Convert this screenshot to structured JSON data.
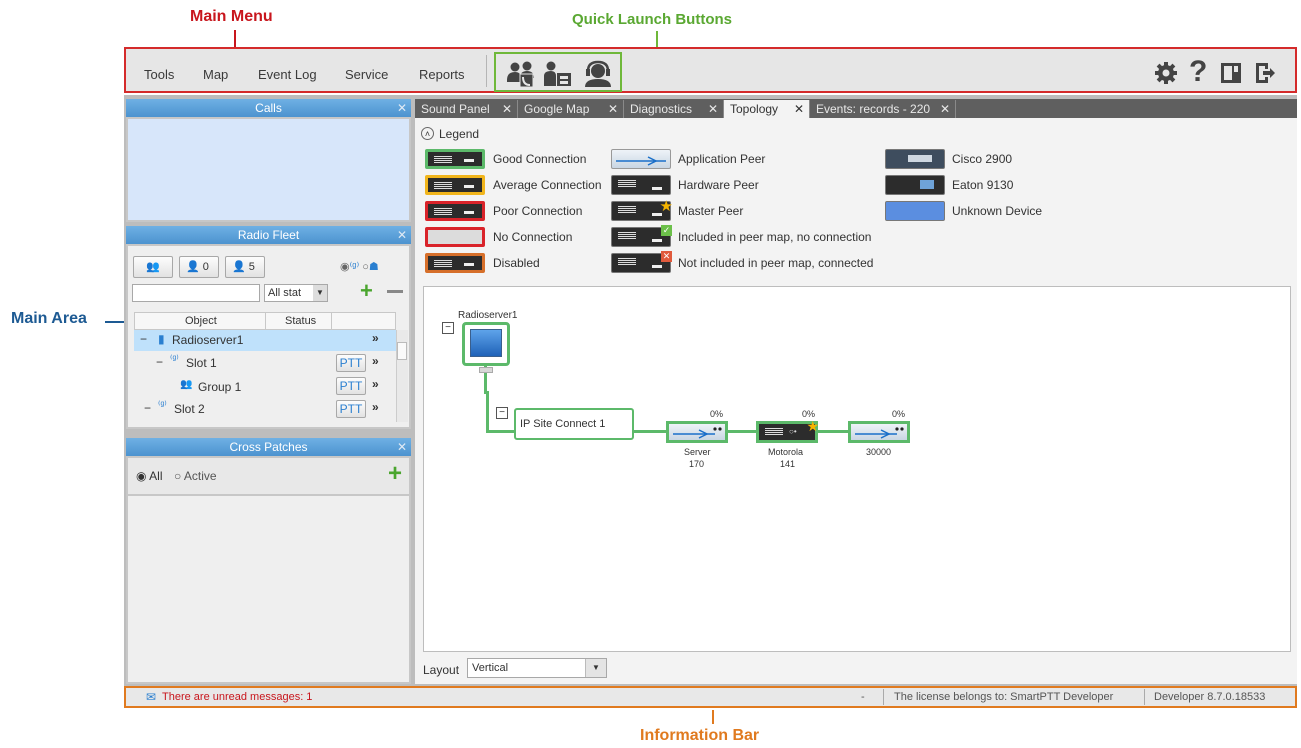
{
  "annotations": {
    "main_menu": "Main Menu",
    "quick_launch": "Quick Launch Buttons",
    "main_area": "Main Area",
    "information_bar": "Information Bar"
  },
  "menu": {
    "items": [
      "Tools",
      "Map",
      "Event Log",
      "Service",
      "Reports"
    ]
  },
  "panels": {
    "calls": {
      "title": "Calls"
    },
    "radio_fleet": {
      "title": "Radio Fleet",
      "btn_count_a": "0",
      "btn_count_b": "5",
      "filter_value": "All stat",
      "col_object": "Object",
      "col_status": "Status",
      "rows": [
        {
          "label": "Radioserver1",
          "ptt": ""
        },
        {
          "label": "Slot 1",
          "ptt": "PTT"
        },
        {
          "label": "Group 1",
          "ptt": "PTT"
        },
        {
          "label": "Slot 2",
          "ptt": "PTT"
        }
      ]
    },
    "cross_patches": {
      "title": "Cross Patches",
      "opt_all": "All",
      "opt_active": "Active"
    }
  },
  "tabs": [
    {
      "label": "Sound Panel",
      "active": false
    },
    {
      "label": "Google Map",
      "active": false
    },
    {
      "label": "Diagnostics",
      "active": false
    },
    {
      "label": "Topology",
      "active": true
    },
    {
      "label": "Events: records - 220",
      "active": false
    }
  ],
  "legend": {
    "title": "Legend",
    "items": [
      "Good Connection",
      "Average Connection",
      "Poor Connection",
      "No Connection",
      "Disabled",
      "Application Peer",
      "Hardware Peer",
      "Master Peer",
      "Included in peer map, no connection",
      "Not included in peer map, connected",
      "Cisco 2900",
      "Eaton 9130",
      "Unknown Device"
    ]
  },
  "topology": {
    "root_label": "Radioserver1",
    "site_label": "IP Site Connect 1",
    "devices": [
      {
        "name": "Server",
        "id": "170",
        "pct": "0%"
      },
      {
        "name": "Motorola",
        "id": "141",
        "pct": "0%"
      },
      {
        "name": "",
        "id": "30000",
        "pct": "0%"
      }
    ],
    "layout_label": "Layout",
    "layout_value": "Vertical"
  },
  "infobar": {
    "message": "There are unread messages: 1",
    "dash": "-",
    "license": "The license belongs to:  SmartPTT Developer",
    "version": "Developer 8.7.0.18533"
  },
  "colors": {
    "good": "#5cb96a",
    "average": "#f1b51c",
    "poor": "#d9232a",
    "none": "#d9232a",
    "disabled": "#d66f2a",
    "accent": "#4c93cf",
    "menu_border": "#d42b2b",
    "ql_border": "#6fb83a",
    "info_border": "#e07a1f"
  }
}
